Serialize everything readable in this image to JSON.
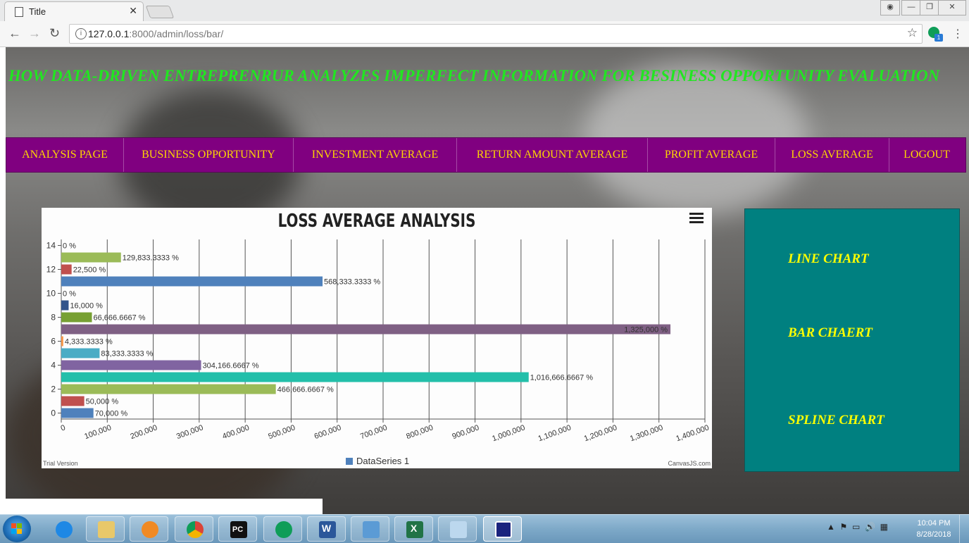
{
  "browser": {
    "tab_title": "Title",
    "tab_close": "✕",
    "url_host": "127.0.0.1",
    "url_rest": ":8000/admin/loss/bar/",
    "ext_badge": "1",
    "min": "—",
    "max": "❐",
    "close": "✕"
  },
  "header": {
    "title": "HOW DATA-DRIVEN ENTREPRENRUR ANALYZES IMPERFECT INFORMATION FOR BESINESS OPPORTUNITY EVALUATION"
  },
  "nav": {
    "items": [
      {
        "label": "ANALYSIS PAGE"
      },
      {
        "label": "BUSINESS OPPORTUNITY"
      },
      {
        "label": "INVESTMENT AVERAGE"
      },
      {
        "label": "RETURN AMOUNT AVERAGE"
      },
      {
        "label": "PROFIT AVERAGE"
      },
      {
        "label": "LOSS AVERAGE"
      },
      {
        "label": "LOGOUT"
      }
    ]
  },
  "side": {
    "line": "LINE CHART",
    "bar": "BAR CHAERT",
    "spline": "SPLINE CHART"
  },
  "chart_footer": {
    "trial": "Trial Version",
    "brand": "CanvasJS.com"
  },
  "colors": {
    "nav_bg": "#800080",
    "nav_text": "#ffd700",
    "title_text": "#21e621",
    "side_bg": "#008080",
    "side_text": "#ffff00"
  },
  "taskbar": {
    "time": "10:04 PM",
    "date": "8/28/2018",
    "apps": [
      "start-icon",
      "ie-icon",
      "explorer-icon",
      "media-player-icon",
      "chrome-icon",
      "pycharm-icon",
      "hangouts-icon",
      "word-icon",
      "photo-viewer-icon",
      "excel-icon",
      "notepad-icon",
      "remote-app-icon"
    ]
  },
  "chart_data": {
    "type": "bar",
    "orientation": "horizontal",
    "title": "LOSS AVERAGE ANALYSIS",
    "legend": "DataSeries 1",
    "legend_position": "bottom",
    "x_ticks": [
      "0",
      "100,000",
      "200,000",
      "300,000",
      "400,000",
      "500,000",
      "600,000",
      "700,000",
      "800,000",
      "900,000",
      "1,000,000",
      "1,100,000",
      "1,200,000",
      "1,300,000",
      "1,400,000"
    ],
    "y_ticks": [
      "0",
      "2",
      "4",
      "6",
      "8",
      "10",
      "12",
      "14"
    ],
    "xlim": [
      0,
      1400000
    ],
    "ylim": [
      -0.5,
      14.5
    ],
    "grid": true,
    "points": [
      {
        "y": 0,
        "value": 70000,
        "label": "70,000 %",
        "color": "#4f81bc"
      },
      {
        "y": 1,
        "value": 50000,
        "label": "50,000 %",
        "color": "#c0504e"
      },
      {
        "y": 2,
        "value": 466666.6667,
        "label": "466,666.6667 %",
        "color": "#9bbb58"
      },
      {
        "y": 3,
        "value": 1016666.6667,
        "label": "1,016,666.6667 %",
        "color": "#23bfaa"
      },
      {
        "y": 4,
        "value": 304166.6667,
        "label": "304,166.6667 %",
        "color": "#8064a1"
      },
      {
        "y": 5,
        "value": 83333.3333,
        "label": "83,333.3333 %",
        "color": "#4aacc5"
      },
      {
        "y": 6,
        "value": 4333.3333,
        "label": "4,333.3333 %",
        "color": "#f79647"
      },
      {
        "y": 7,
        "value": 1325000,
        "label": "1,325,000 %",
        "color": "#7f6084"
      },
      {
        "y": 8,
        "value": 66666.6667,
        "label": "66,666.6667 %",
        "color": "#77a033"
      },
      {
        "y": 9,
        "value": 16000,
        "label": "16,000 %",
        "color": "#33558b"
      },
      {
        "y": 10,
        "value": 0,
        "label": "0 %",
        "color": "#e64a19"
      },
      {
        "y": 11,
        "value": 568333.3333,
        "label": "568,333.3333 %",
        "color": "#4f81bc"
      },
      {
        "y": 12,
        "value": 22500,
        "label": "22,500 %",
        "color": "#c0504e"
      },
      {
        "y": 13,
        "value": 129833.3333,
        "label": "129,833.3333 %",
        "color": "#9bbb58"
      },
      {
        "y": 14,
        "value": 0,
        "label": "0 %",
        "color": "#23bfaa"
      }
    ]
  }
}
